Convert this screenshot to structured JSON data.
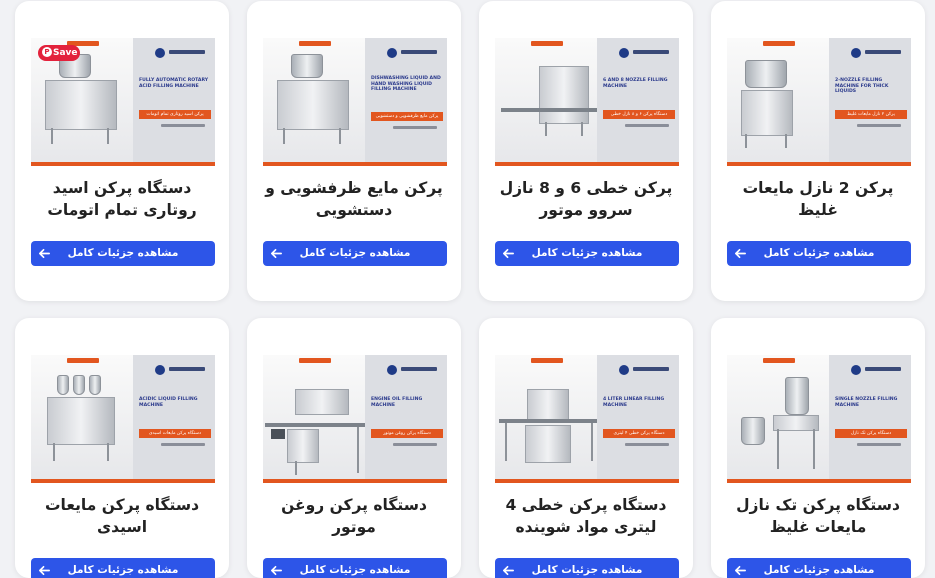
{
  "products": [
    {
      "title": "پرکن 2 نازل مایعات غلیظ",
      "thumb_title": "2-NOZZLE FILLING MACHINE FOR THICK LIQUIDS",
      "thumb_fa": "پرکن ۲ نازل مایعات غلیظ",
      "button_label": "مشاهده جزئیات کامل"
    },
    {
      "title": "پرکن خطی 6 و 8 نازل سروو موتور",
      "thumb_title": "6 AND 8 NOZZLE FILLING MACHINE",
      "thumb_fa": "دستگاه پرکن ۶ و ۸ نازل خطی",
      "button_label": "مشاهده جزئیات کامل"
    },
    {
      "title": "پرکن مایع ظرفشویی و دستشویی",
      "thumb_title": "DISHWASHING LIQUID AND HAND WASHING LIQUID FILLING MACHINE",
      "thumb_fa": "پرکن مایع ظرفشویی و دستشویی",
      "button_label": "مشاهده جزئیات کامل"
    },
    {
      "title": "دستگاه پرکن اسید روتاری تمام اتومات",
      "thumb_title": "FULLY AUTOMATIC ROTARY ACID FILLING MACHINE",
      "thumb_fa": "پرکن اسید روتاری تمام اتومات",
      "button_label": "مشاهده جزئیات کامل",
      "save_label": "Save"
    },
    {
      "title": "دستگاه پرکن تک نازل مایعات غلیظ",
      "thumb_title": "SINGLE NOZZLE FILLING MACHINE",
      "thumb_fa": "دستگاه پرکن تک نازل",
      "button_label": "مشاهده جزئیات کامل"
    },
    {
      "title": "دستگاه پرکن خطی 4 لیتری مواد شوینده",
      "thumb_title": "4 LITER LINEAR FILLING MACHINE",
      "thumb_fa": "دستگاه پرکن خطی ۴ لیتری",
      "button_label": "مشاهده جزئیات کامل"
    },
    {
      "title": "دستگاه پرکن روغن موتور",
      "thumb_title": "ENGINE OIL FILLING MACHINE",
      "thumb_fa": "دستگاه پرکن روغن موتور",
      "button_label": "مشاهده جزئیات کامل"
    },
    {
      "title": "دستگاه پرکن مایعات اسیدی",
      "thumb_title": "ACIDIC LIQUID FILLING MACHINE",
      "thumb_fa": "دستگاه پرکن مایعات اسیدی",
      "button_label": "مشاهده جزئیات کامل"
    }
  ],
  "colors": {
    "button": "#2d55e8",
    "accent_orange": "#e2561f",
    "save_badge": "#e3223c"
  }
}
